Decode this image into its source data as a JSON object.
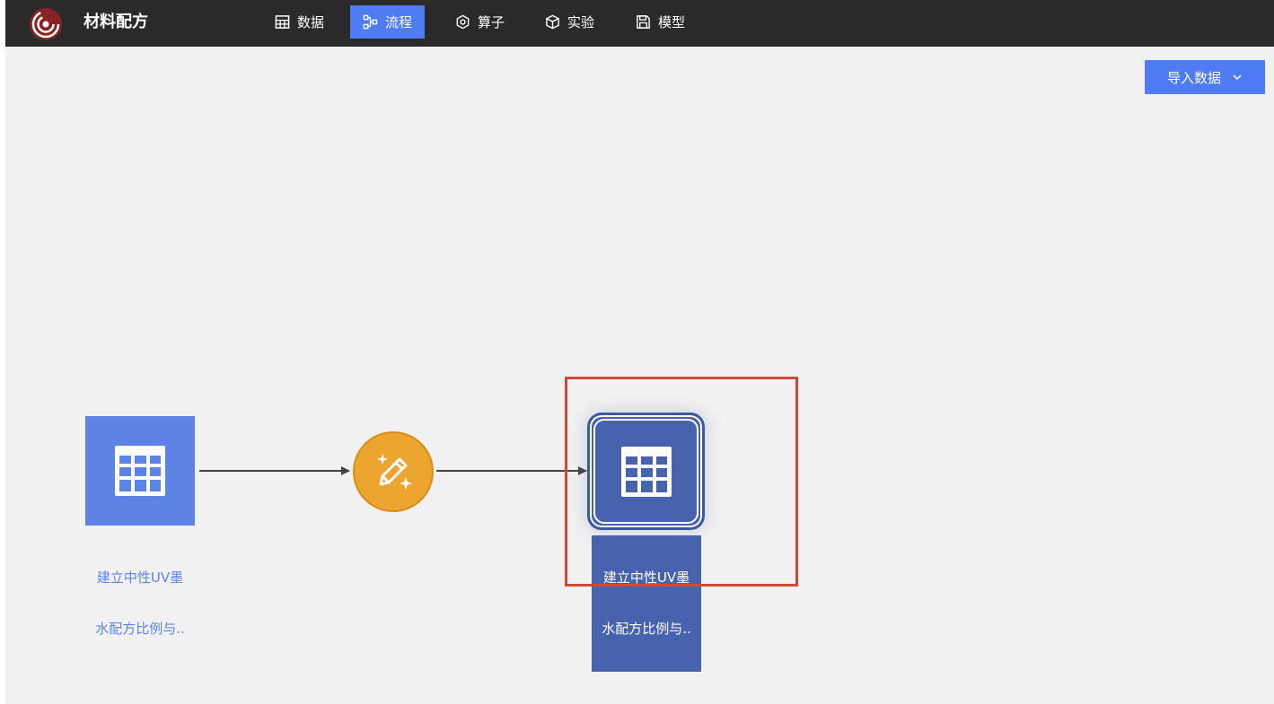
{
  "app": {
    "title": "材料配方"
  },
  "nav": {
    "items": [
      {
        "label": "数据",
        "icon": "table-icon",
        "active": false
      },
      {
        "label": "流程",
        "icon": "flow-icon",
        "active": true
      },
      {
        "label": "算子",
        "icon": "operator-icon",
        "active": false
      },
      {
        "label": "实验",
        "icon": "cube-icon",
        "active": false
      },
      {
        "label": "模型",
        "icon": "save-icon",
        "active": false
      }
    ]
  },
  "toolbar": {
    "import_label": "导入数据",
    "import_icon": "chevron-down-icon"
  },
  "flow": {
    "nodes": [
      {
        "id": "source",
        "type": "dataset",
        "icon": "table-icon",
        "label_line1": "建立中性UV墨",
        "label_line2": "水配方比例与..",
        "color": "#5d83e5"
      },
      {
        "id": "operator",
        "type": "operator",
        "icon": "magic-pencil-icon",
        "color": "#eca52f"
      },
      {
        "id": "output",
        "type": "dataset",
        "icon": "table-icon",
        "label_line1": "建立中性UV墨",
        "label_line2": "水配方比例与..",
        "color": "#4763ad",
        "selected": true
      }
    ]
  },
  "colors": {
    "accent": "#4f7cf5",
    "topbar": "#2a2a2a",
    "canvas": "#f1f1f1",
    "highlight": "#cc4a38"
  }
}
